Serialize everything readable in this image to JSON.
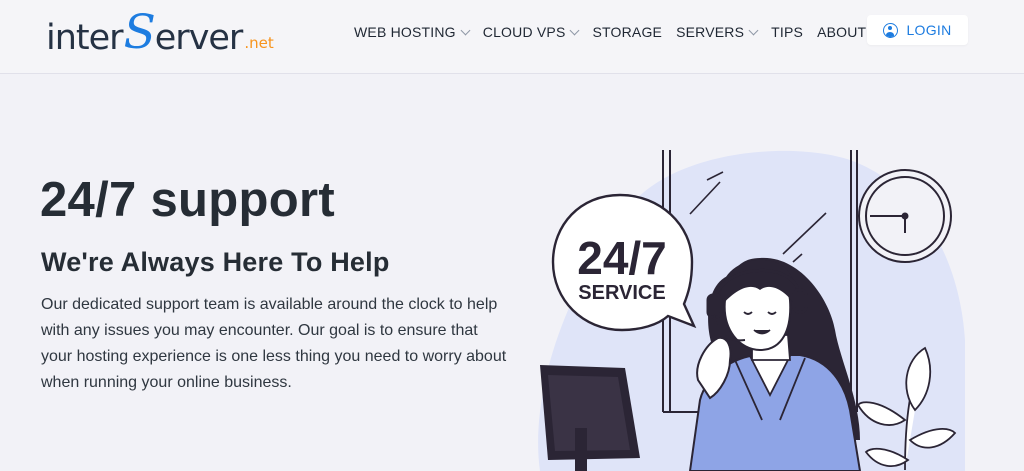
{
  "brand": {
    "logo_inter": "inter",
    "logo_s": "S",
    "logo_erver": "erver",
    "logo_tld": ".net"
  },
  "nav": {
    "items": [
      {
        "label": "WEB HOSTING",
        "has_dropdown": true
      },
      {
        "label": "CLOUD VPS",
        "has_dropdown": true
      },
      {
        "label": "STORAGE",
        "has_dropdown": false
      },
      {
        "label": "SERVERS",
        "has_dropdown": true
      },
      {
        "label": "TIPS",
        "has_dropdown": false
      },
      {
        "label": "ABOUT US",
        "has_dropdown": true
      }
    ],
    "login_label": "LOGIN"
  },
  "hero": {
    "title": "24/7 support",
    "subtitle": "We're Always Here To Help",
    "body": "Our dedicated support team is available around the clock to help with any issues you may encounter. Our goal is to ensure that your hosting experience is one less thing you need to worry about when running your online business."
  },
  "illustration": {
    "bubble_number": "24/7",
    "bubble_word": "SERVICE"
  },
  "colors": {
    "accent_blue": "#1d7ce0",
    "brand_orange": "#f7941d",
    "text_dark": "#262d35",
    "background": "#f2f2f7",
    "illustration_blue": "#dfe4f8",
    "jacket_blue": "#8ea4e6",
    "outline": "#2b2535"
  },
  "icons": {
    "login": "user-circle-icon",
    "dropdown": "chevron-down-icon"
  }
}
